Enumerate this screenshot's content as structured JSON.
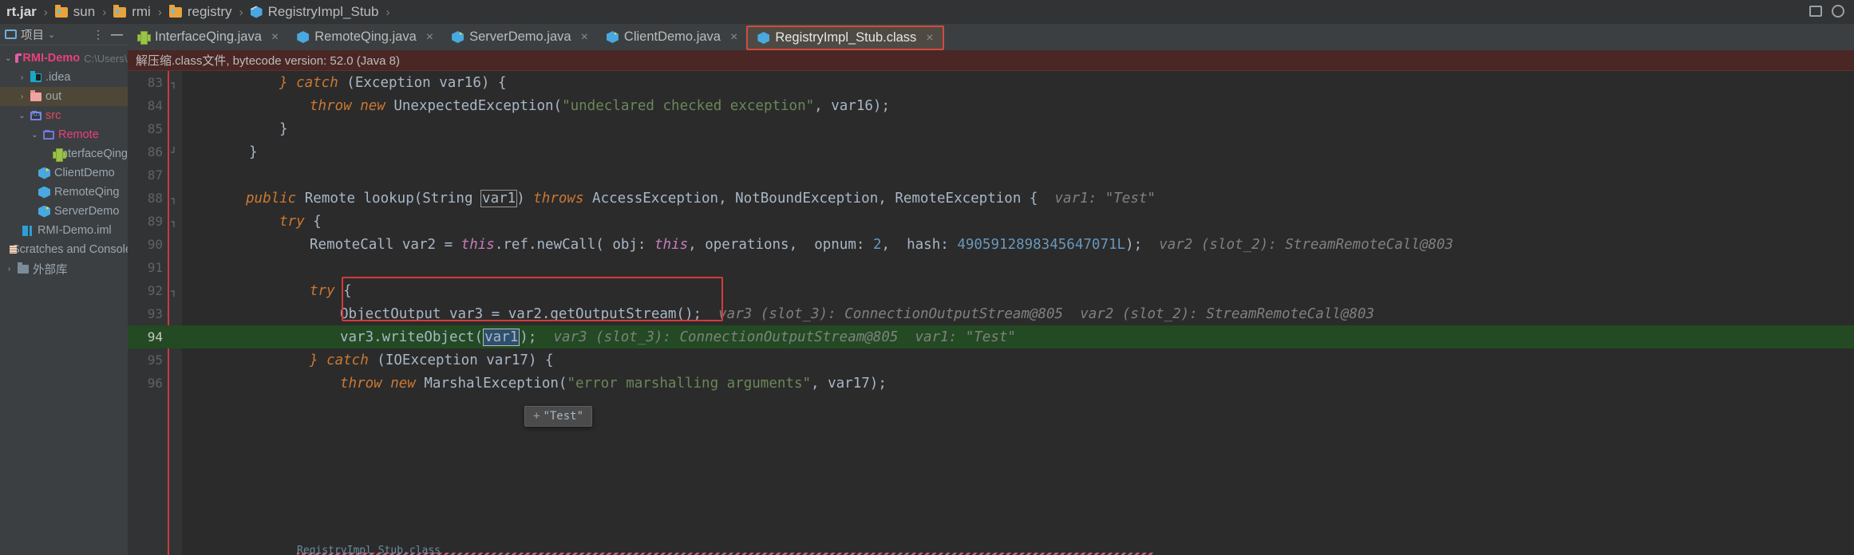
{
  "breadcrumb": {
    "items": [
      {
        "label": "rt.jar",
        "icon": "none",
        "bold": true
      },
      {
        "label": "sun",
        "icon": "folder-icon",
        "bold": false
      },
      {
        "label": "rmi",
        "icon": "folder-icon",
        "bold": false
      },
      {
        "label": "registry",
        "icon": "folder-icon",
        "bold": false
      },
      {
        "label": "RegistryImpl_Stub",
        "icon": "class-file-icon",
        "bold": false
      }
    ],
    "separator": "›"
  },
  "window_controls": {
    "maximize_icon": "maximize-icon",
    "settings_icon": "gear-icon"
  },
  "tabs": [
    {
      "label": "InterfaceQing.java",
      "icon": "interface-icon",
      "active": false,
      "close": "×"
    },
    {
      "label": "RemoteQing.java",
      "icon": "class-icon",
      "active": false,
      "close": "×"
    },
    {
      "label": "ServerDemo.java",
      "icon": "runnable-class-icon",
      "active": false,
      "close": "×"
    },
    {
      "label": "ClientDemo.java",
      "icon": "runnable-class-icon",
      "active": false,
      "close": "×"
    },
    {
      "label": "RegistryImpl_Stub.class",
      "icon": "class-file-icon",
      "active": true,
      "close": "×"
    }
  ],
  "sidebar": {
    "title": "项目",
    "project_icon": "project-icon",
    "chevron": "⌄",
    "more_icon": "more-options-icon",
    "collapse_icon": "collapse-all-icon",
    "tree": [
      {
        "label": "RMI-Demo",
        "path": "C:\\Users\\Admin",
        "icon": "folder-magenta-icon",
        "arrow": "⌄",
        "indent": 0,
        "style": "pink-bold",
        "selected": false
      },
      {
        "label": ".idea",
        "path": "",
        "icon": "folder-idea-icon",
        "arrow": "›",
        "indent": 1,
        "style": "gray",
        "selected": false
      },
      {
        "label": "out",
        "path": "",
        "icon": "folder-out-icon",
        "arrow": "›",
        "indent": 1,
        "style": "gray",
        "selected": true
      },
      {
        "label": "src",
        "path": "",
        "icon": "folder-src-icon",
        "arrow": "⌄",
        "indent": 1,
        "style": "red",
        "selected": false
      },
      {
        "label": "Remote",
        "path": "",
        "icon": "folder-remote-icon",
        "arrow": "⌄",
        "indent": 2,
        "style": "pink",
        "selected": false
      },
      {
        "label": "InterfaceQing",
        "path": "",
        "icon": "interface-icon",
        "arrow": "",
        "indent": 3,
        "style": "gray",
        "selected": false
      },
      {
        "label": "ClientDemo",
        "path": "",
        "icon": "runnable-class-icon",
        "arrow": "",
        "indent": 2,
        "style": "gray",
        "selected": false
      },
      {
        "label": "RemoteQing",
        "path": "",
        "icon": "class-icon",
        "arrow": "",
        "indent": 2,
        "style": "gray",
        "selected": false
      },
      {
        "label": "ServerDemo",
        "path": "",
        "icon": "runnable-class-icon",
        "arrow": "",
        "indent": 2,
        "style": "gray",
        "selected": false
      },
      {
        "label": "RMI-Demo.iml",
        "path": "",
        "icon": "iml-file-icon",
        "arrow": "",
        "indent": 1,
        "style": "gray",
        "selected": false
      },
      {
        "label": "Scratches and Consoles",
        "path": "",
        "icon": "scratches-icon",
        "arrow": "",
        "indent": 0,
        "style": "gray",
        "selected": false
      },
      {
        "label": "外部库",
        "path": "",
        "icon": "external-libraries-icon",
        "arrow": "›",
        "indent": 0,
        "style": "gray",
        "selected": false
      }
    ]
  },
  "notification": {
    "text": "解压缩.class文件, bytecode version: 52.0 (Java 8)"
  },
  "editor": {
    "lines": [
      {
        "num": "83",
        "fold": "┐",
        "highlight": false
      },
      {
        "num": "84",
        "fold": "",
        "highlight": false
      },
      {
        "num": "85",
        "fold": "",
        "highlight": false
      },
      {
        "num": "86",
        "fold": "┘",
        "highlight": false
      },
      {
        "num": "87",
        "fold": "",
        "highlight": false
      },
      {
        "num": "88",
        "fold": "┐",
        "highlight": false
      },
      {
        "num": "89",
        "fold": "┐",
        "highlight": false
      },
      {
        "num": "90",
        "fold": "",
        "highlight": false
      },
      {
        "num": "91",
        "fold": "",
        "highlight": false
      },
      {
        "num": "92",
        "fold": "┐",
        "highlight": false
      },
      {
        "num": "93",
        "fold": "",
        "highlight": false
      },
      {
        "num": "94",
        "fold": "",
        "highlight": true
      },
      {
        "num": "95",
        "fold": "",
        "highlight": false
      },
      {
        "num": "96",
        "fold": "",
        "highlight": false
      }
    ],
    "code": {
      "l83_catch": "} catch ",
      "l83_rest": "(Exception var16) {",
      "l84_throw": "throw new ",
      "l84_call": "UnexpectedException(",
      "l84_str": "\"undeclared checked exception\"",
      "l84_end": ", var16);",
      "l85": "}",
      "l86": "}",
      "l88_pub": "public ",
      "l88_sig1": "Remote lookup(String ",
      "l88_var": "var1",
      "l88_sig2": ") ",
      "l88_throws": "throws ",
      "l88_sig3": "AccessException, NotBoundException, RemoteException {",
      "l88_hint": "var1: \"Test\"",
      "l89_try": "try ",
      "l89_brace": "{",
      "l90_a": "RemoteCall var2 = ",
      "l90_this": "this",
      "l90_b": ".ref.newCall( obj: ",
      "l90_this2": "this",
      "l90_c": ", operations,  opnum: ",
      "l90_num": "2",
      "l90_d": ",  hash: ",
      "l90_hash": "4905912898345647071L",
      "l90_e": ");",
      "l90_hint": "var2 (slot_2): StreamRemoteCall@803",
      "l92_try": "try ",
      "l92_brace": "{",
      "l93_code": "ObjectOutput var3 = var2.getOutputStream();",
      "l93_hint1": "var3 (slot_3): ConnectionOutputStream@805",
      "l93_hint2": "var2 (slot_2): StreamRemoteCall@803",
      "l94_a": "var3.writeObject(",
      "l94_var": "var1",
      "l94_b": ");",
      "l94_hint1": "var3 (slot_3): ConnectionOutputStream@805",
      "l94_hint2": "var1: \"Test\"",
      "l95_a": "} catch ",
      "l95_b": "(IOException var17) {",
      "l96_throw": "throw new ",
      "l96_call": "MarshalException(",
      "l96_str": "\"error marshalling arguments\"",
      "l96_end": ", var17);"
    },
    "tooltip": {
      "plus": "+",
      "value": "\"Test\""
    },
    "bottom_text": "RegistryImpl_Stub.class"
  }
}
